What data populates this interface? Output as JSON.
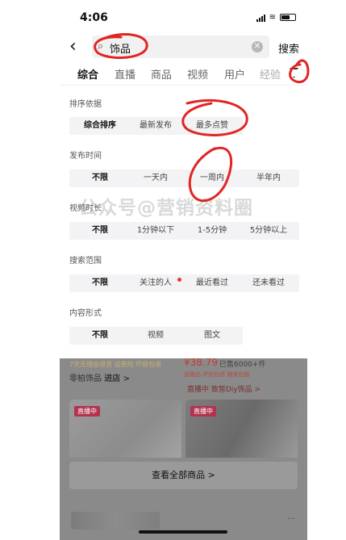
{
  "status_bar": {
    "time": "4:06"
  },
  "search": {
    "query": "饰品",
    "clear_icon": "clear-icon",
    "search_button": "搜索",
    "back_icon": "back-arrow-icon"
  },
  "tabs": {
    "items": [
      "综合",
      "直播",
      "商品",
      "视频",
      "用户",
      "经验"
    ],
    "active": "综合"
  },
  "filters": {
    "sort": {
      "title": "排序依据",
      "options": [
        "综合排序",
        "最新发布",
        "最多点赞"
      ],
      "selected": "综合排序"
    },
    "publish_time": {
      "title": "发布时间",
      "options": [
        "不限",
        "一天内",
        "一周内",
        "半年内"
      ],
      "selected": "不限"
    },
    "video_length": {
      "title": "视频时长",
      "options": [
        "不限",
        "1分钟以下",
        "1-5分钟",
        "5分钟以上"
      ],
      "selected": "不限"
    },
    "scope": {
      "title": "搜索范围",
      "options": [
        "不限",
        "关注的人",
        "最近看过",
        "还未看过"
      ],
      "selected": "不限"
    },
    "format": {
      "title": "内容形式",
      "options": [
        "不限",
        "视频",
        "图文"
      ],
      "selected": "不限"
    }
  },
  "watermark": "公众号@营销资料圈",
  "results": {
    "shop_tags": "7天无理由退货  运费险  坏损包退",
    "shop_name": "零柏饰品",
    "enter_shop": "进店 >",
    "price": "¥38.79",
    "sold": "已售6000+件",
    "promo_tags": "送赠品  坏损包退  晚发包赔",
    "live_line": "直播中  致暂Diy饰品 >",
    "card_badge": "直播中",
    "see_all": "查看全部商品 >",
    "more": "···"
  },
  "colors": {
    "accent_red": "#e02b2b",
    "annotation": "#e22424",
    "overlay": "#8a8a8a"
  }
}
